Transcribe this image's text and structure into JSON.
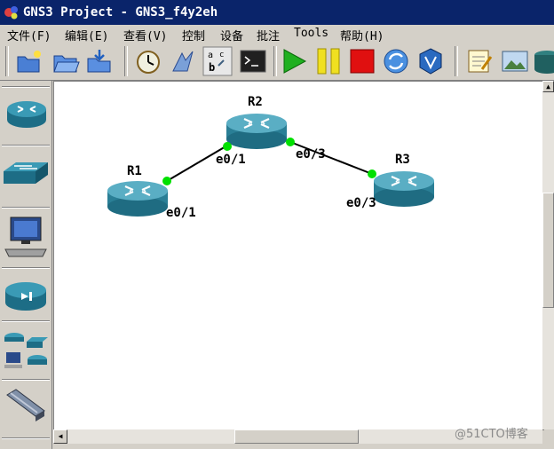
{
  "window": {
    "title": "GNS3 Project - GNS3_f4y2eh"
  },
  "menu": {
    "items": [
      {
        "label": "文件(F)"
      },
      {
        "label": "编辑(E)"
      },
      {
        "label": "查看(V)"
      },
      {
        "label": "控制"
      },
      {
        "label": "设备"
      },
      {
        "label": "批注"
      },
      {
        "label": "Tools"
      },
      {
        "label": "帮助(H)"
      }
    ]
  },
  "toolbar": {
    "icons": [
      "new-project-icon",
      "open-project-icon",
      "save-project-icon",
      "snapshot-icon",
      "topology-icon",
      "show-interface-labels-icon",
      "console-icon",
      "start-icon",
      "pause-icon",
      "stop-icon",
      "reload-icon",
      "virtualbox-icon",
      "note-icon",
      "image-icon",
      "drawing-icon"
    ]
  },
  "devices_panel": {
    "icons": [
      "router-icon",
      "switch-icon",
      "end-device-icon",
      "security-device-icon",
      "all-devices-icon",
      "link-icon"
    ]
  },
  "topology": {
    "nodes": [
      {
        "name": "R1"
      },
      {
        "name": "R2"
      },
      {
        "name": "R3"
      }
    ],
    "links": [
      {
        "from": "R1",
        "from_port": "e0/1",
        "to": "R2",
        "to_port": "e0/1"
      },
      {
        "from": "R2",
        "from_port": "e0/3",
        "to": "R3",
        "to_port": "e0/3"
      }
    ],
    "colors": {
      "link_status": "#00e000",
      "router": "#3a8fa0"
    }
  },
  "watermark": "@51CTO博客"
}
